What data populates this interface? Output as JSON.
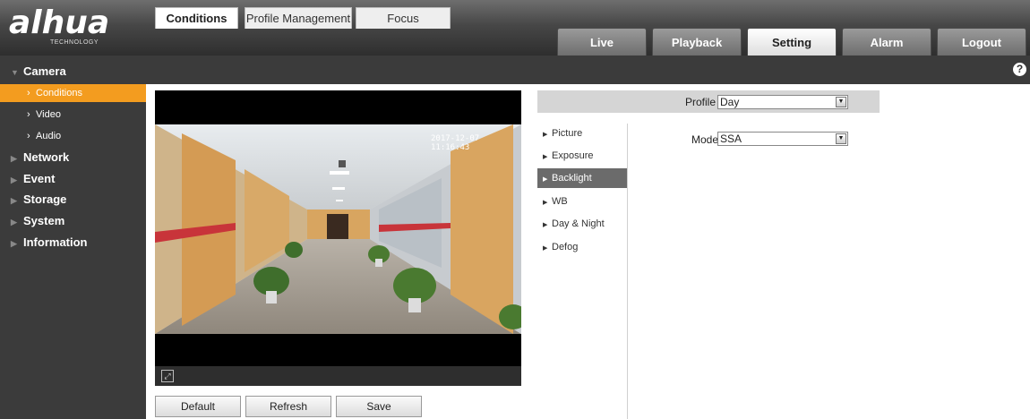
{
  "header": {
    "logo": "alhua",
    "logo_sub": "TECHNOLOGY",
    "tabs": [
      {
        "label": "Live"
      },
      {
        "label": "Playback"
      },
      {
        "label": "Setting"
      },
      {
        "label": "Alarm"
      },
      {
        "label": "Logout"
      }
    ],
    "active_tab": "Setting"
  },
  "sidebar": {
    "camera": "Camera",
    "sub_items": [
      {
        "label": "Conditions"
      },
      {
        "label": "Video"
      },
      {
        "label": "Audio"
      }
    ],
    "items": [
      {
        "label": "Network"
      },
      {
        "label": "Event"
      },
      {
        "label": "Storage"
      },
      {
        "label": "System"
      },
      {
        "label": "Information"
      }
    ]
  },
  "subtabs": [
    {
      "label": "Conditions"
    },
    {
      "label": "Profile Management"
    },
    {
      "label": "Focus"
    }
  ],
  "help": "?",
  "video": {
    "timestamp": "2017-12-07 11:16:43"
  },
  "buttons": {
    "default": "Default",
    "refresh": "Refresh",
    "save": "Save"
  },
  "settings": {
    "profile_label": "Profile",
    "profile_value": "Day",
    "mode_label": "Mode",
    "mode_value": "SSA",
    "menu": [
      {
        "label": "Picture"
      },
      {
        "label": "Exposure"
      },
      {
        "label": "Backlight"
      },
      {
        "label": "WB"
      },
      {
        "label": "Day & Night"
      },
      {
        "label": "Defog"
      }
    ],
    "active_menu": "Backlight"
  },
  "colors": {
    "accent": "#f39c1f",
    "header_dark": "#3b3b3b",
    "menu_active": "#6b6b6b"
  }
}
